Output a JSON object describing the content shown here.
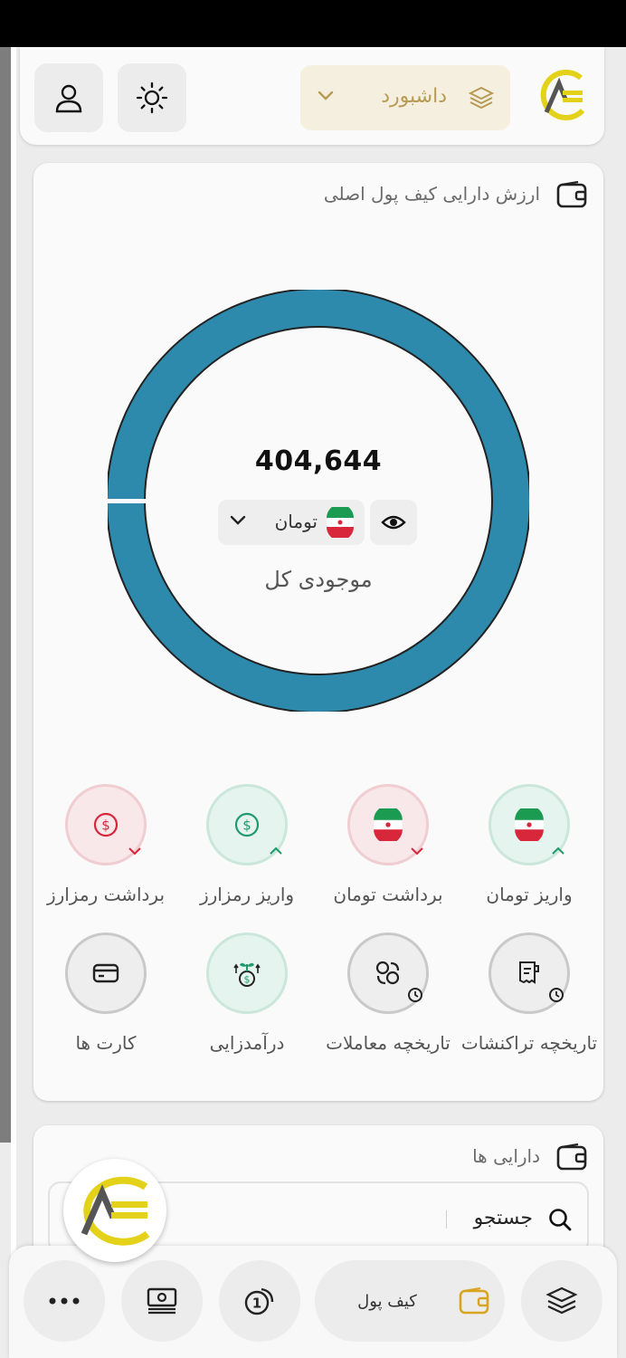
{
  "header": {
    "dashboard_label": "داشبورد",
    "icons": {
      "theme": "sun-icon",
      "profile": "user-icon",
      "section": "layers-icon",
      "expand": "chevron-down-icon",
      "brand": "ace-logo"
    }
  },
  "wallet": {
    "title": "ارزش دارایی کیف پول اصلی",
    "balance": "404,644",
    "currency": "تومان",
    "total_label": "موجودی کل",
    "ring_color": "#2e8aad"
  },
  "actions": [
    {
      "label": "واریز تومان",
      "icon": "iran-flag-icon",
      "tone": "green"
    },
    {
      "label": "برداشت تومان",
      "icon": "iran-flag-icon",
      "tone": "red"
    },
    {
      "label": "واریز رمزارز",
      "icon": "dollar-icon",
      "tone": "green"
    },
    {
      "label": "برداشت رمزارز",
      "icon": "dollar-icon",
      "tone": "red"
    },
    {
      "label": "تاریخچه تراکنشات",
      "icon": "receipt-history-icon",
      "tone": "gray"
    },
    {
      "label": "تاریخچه معاملات",
      "icon": "exchange-history-icon",
      "tone": "gray"
    },
    {
      "label": "درآمدزایی",
      "icon": "money-growth-icon",
      "tone": "green"
    },
    {
      "label": "کارت ها",
      "icon": "card-icon",
      "tone": "gray"
    }
  ],
  "assets": {
    "title": "دارایی ها",
    "search_placeholder": "جستجو"
  },
  "bottom_nav": {
    "wallet_label": "کیف پول"
  },
  "colors": {
    "accent": "#d9a520",
    "green": "#1f9a6b",
    "red": "#d8263a",
    "brand_yellow": "#e4d21a"
  }
}
